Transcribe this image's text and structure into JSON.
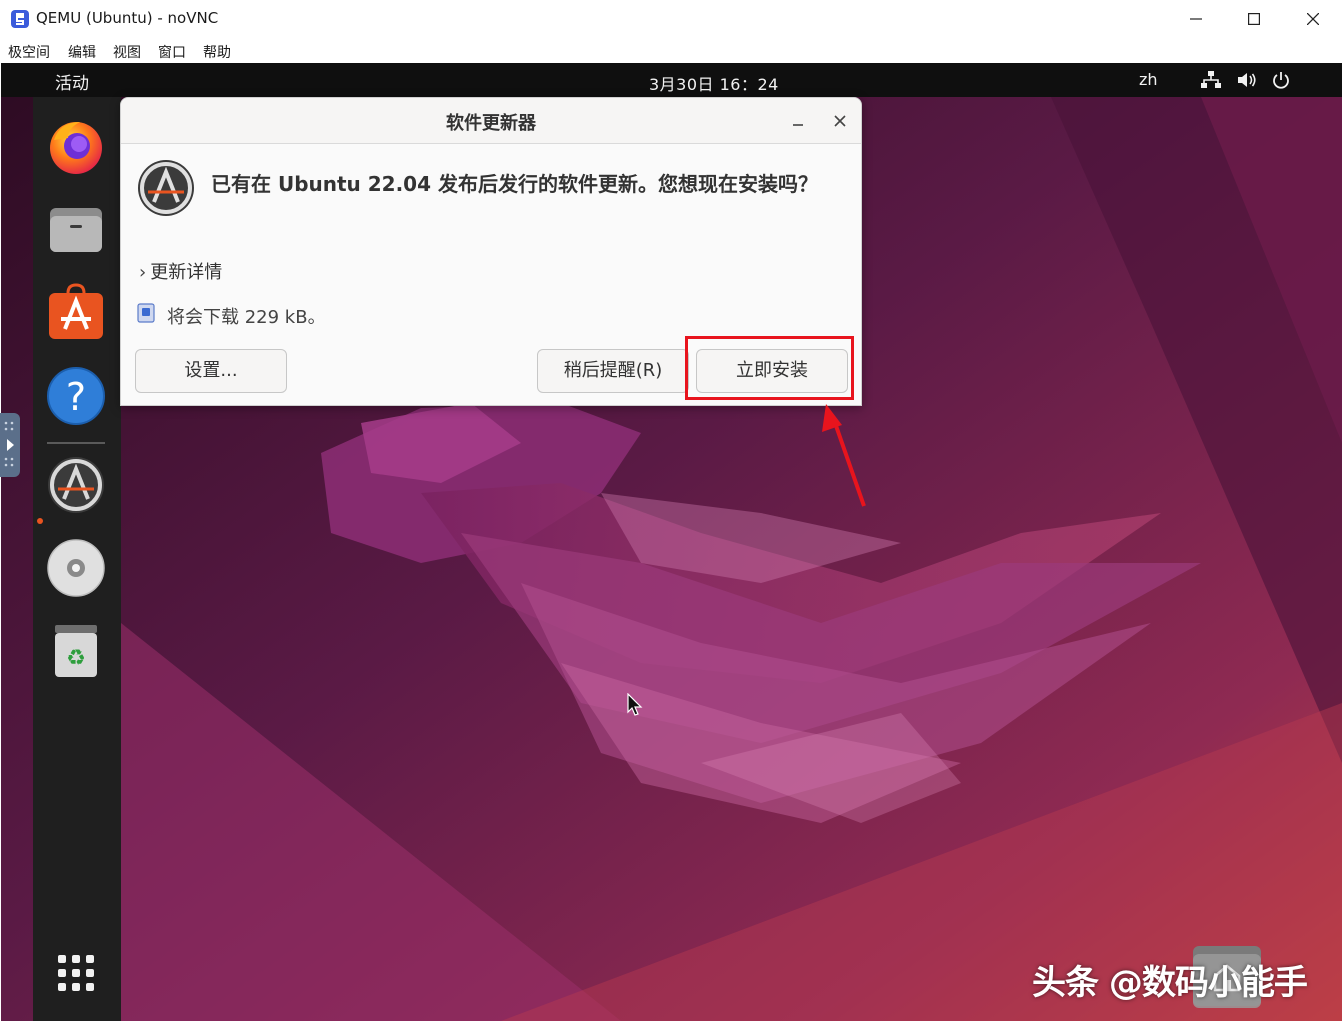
{
  "window": {
    "title": "QEMU (Ubuntu) - noVNC",
    "controls": [
      "minimize",
      "maximize",
      "close"
    ]
  },
  "menubar": {
    "items": [
      {
        "label": "极空间"
      },
      {
        "label": "编辑"
      },
      {
        "label": "视图"
      },
      {
        "label": "窗口"
      },
      {
        "label": "帮助"
      }
    ]
  },
  "topbar": {
    "activities": "活动",
    "clock": "3月30日  16：24",
    "language": "zh",
    "tray_icons": [
      "network-icon",
      "volume-icon",
      "power-icon"
    ]
  },
  "dock": {
    "items": [
      {
        "name": "firefox-icon"
      },
      {
        "name": "files-icon"
      },
      {
        "name": "app-center-icon"
      },
      {
        "name": "help-icon"
      },
      {
        "name": "software-updater-icon",
        "running": true
      },
      {
        "name": "disc-icon"
      },
      {
        "name": "trash-icon"
      },
      {
        "name": "show-apps-icon"
      }
    ]
  },
  "dialog": {
    "title": "软件更新器",
    "message": "已有在 Ubuntu 22.04 发布后发行的软件更新。您想现在安装吗？",
    "details_label": "更新详情",
    "download_text": "将会下载 229 kB。",
    "buttons": {
      "settings": "设置...",
      "remind_later": "稍后提醒(R)",
      "install_now": "立即安装"
    }
  },
  "annotation": {
    "highlight_color": "#e8141d",
    "target": "install_now"
  },
  "watermark": "头条 @数码小能手",
  "colors": {
    "topbar": "#0f0f0f",
    "dock": "#1f1f1f",
    "accent": "#e95420",
    "dialog_bg": "#fafafa"
  }
}
